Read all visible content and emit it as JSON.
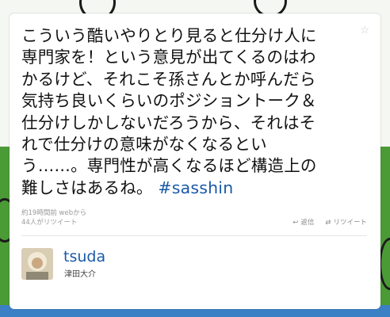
{
  "tweet": {
    "lines": [
      "こういう酷いやりとり見ると仕分け人に",
      "専門家を！という意見が出てくるのはわ",
      "かるけど、それこそ孫さんとか呼んだら",
      "気持ち良いくらいのポジショントーク＆",
      "仕分けしかしないだろうから、それはそ",
      "れで仕分けの意味がなくなるとい",
      "う……。専門性が高くなるほど構造上の"
    ],
    "last_line_text": "難しさはあるね。",
    "hashtag": "#sasshin",
    "time_source": "約19時間前 webから",
    "retweet_count": "44人がリツイート",
    "reply_label": "返信",
    "retweet_label": "リツイート"
  },
  "author": {
    "username": "tsuda",
    "display_name": "津田大介"
  },
  "icons": {
    "favorite": "star-icon",
    "reply": "reply-icon",
    "retweet": "retweet-icon"
  },
  "colors": {
    "link": "#1a59a8",
    "text": "#111111",
    "meta": "#9a9a9a"
  }
}
